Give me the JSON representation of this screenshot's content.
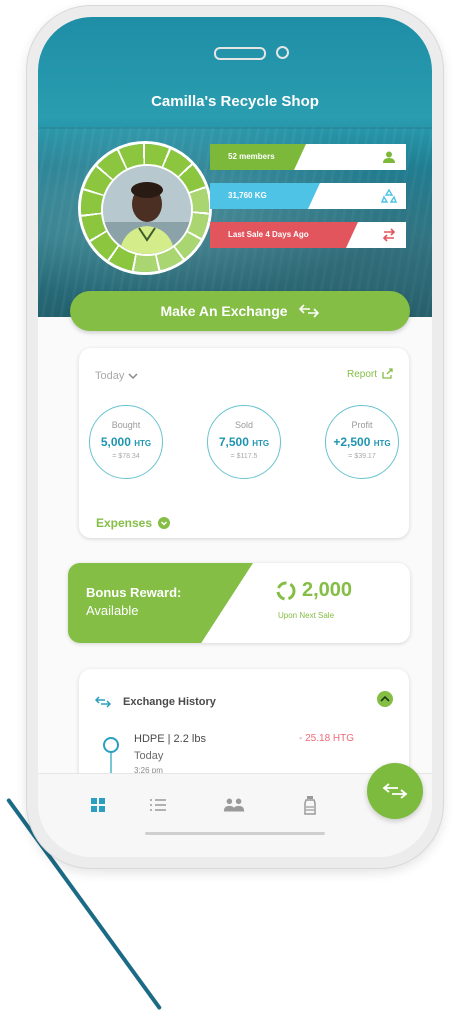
{
  "header": {
    "shop_name": "Camilla's Recycle Shop"
  },
  "stats": {
    "members": "52 members",
    "weight": "31,760 KG",
    "last_sale": "Last Sale 4 Days Ago"
  },
  "actions": {
    "make_exchange": "Make An Exchange"
  },
  "summary": {
    "period": "Today",
    "report_label": "Report",
    "metrics": [
      {
        "label": "Bought",
        "value": "5,000",
        "unit": "HTG",
        "usd": "= $78.34"
      },
      {
        "label": "Sold",
        "value": "7,500",
        "unit": "HTG",
        "usd": "= $117.5"
      },
      {
        "label": "Profit",
        "value": "+2,500",
        "unit": "HTG",
        "usd": "= $39.17"
      }
    ],
    "expenses_label": "Expenses"
  },
  "bonus": {
    "title": "Bonus Reward:",
    "status": "Available",
    "amount": "2,000",
    "note": "Upon Next Sale"
  },
  "history": {
    "title": "Exchange History",
    "items": [
      {
        "item": "HDPE | 2.2 lbs",
        "date": "Today",
        "time": "3:26 pm",
        "amount": "- 25.18 HTG"
      }
    ]
  },
  "colors": {
    "primary_green": "#84be45",
    "teal": "#1f94b0",
    "negative": "#ec6b79",
    "members_tag": "#7cb93a",
    "weight_tag": "#4fc3e6",
    "last_sale_tag": "#e2555d"
  },
  "icons": {
    "members": "person-icon",
    "weight": "recycle-icon",
    "last_sale": "exchange-arrows-icon",
    "tabs": [
      "dashboard-icon",
      "list-icon",
      "people-icon",
      "bottle-icon"
    ],
    "fab": "exchange-arrows-icon"
  }
}
